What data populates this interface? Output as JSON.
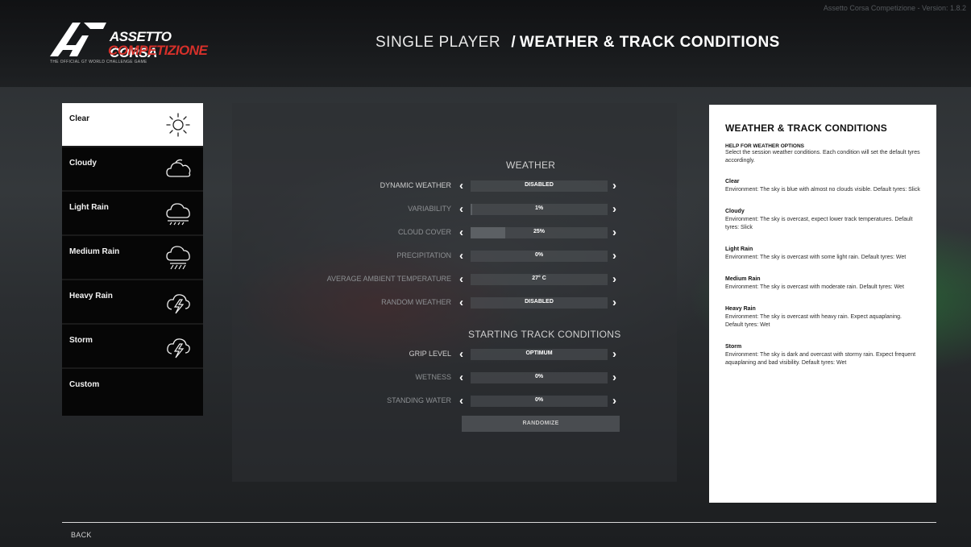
{
  "app": {
    "version": "Assetto Corsa Competizione - Version: 1.8.2",
    "logo_line1": "ASSETTO CORSA",
    "logo_line2": "COMPETIZIONE",
    "logo_tagline": "THE OFFICIAL GT WORLD CHALLENGE GAME"
  },
  "header": {
    "crumb": "SINGLE PLAYER",
    "separator": "/",
    "page": "WEATHER & TRACK CONDITIONS"
  },
  "presets": [
    {
      "label": "Clear",
      "icon": "sun-icon",
      "selected": true
    },
    {
      "label": "Cloudy",
      "icon": "cloud-icon",
      "selected": false
    },
    {
      "label": "Light Rain",
      "icon": "light-rain-icon",
      "selected": false
    },
    {
      "label": "Medium Rain",
      "icon": "medium-rain-icon",
      "selected": false
    },
    {
      "label": "Heavy Rain",
      "icon": "heavy-rain-storm-icon",
      "selected": false
    },
    {
      "label": "Storm",
      "icon": "storm-icon",
      "selected": false
    },
    {
      "label": "Custom",
      "icon": "",
      "selected": false
    }
  ],
  "weather": {
    "title": "WEATHER",
    "rows": [
      {
        "label": "DYNAMIC WEATHER",
        "value": "DISABLED",
        "fill": 0,
        "dim": false
      },
      {
        "label": "VARIABILITY",
        "value": "1%",
        "fill": 0.01,
        "dim": true
      },
      {
        "label": "CLOUD COVER",
        "value": "25%",
        "fill": 0.25,
        "dim": true
      },
      {
        "label": "PRECIPITATION",
        "value": "0%",
        "fill": 0,
        "dim": true
      },
      {
        "label": "AVERAGE AMBIENT TEMPERATURE",
        "value": "27° C",
        "fill": 0,
        "dim": true
      },
      {
        "label": "RANDOM WEATHER",
        "value": "DISABLED",
        "fill": 0,
        "dim": true
      }
    ]
  },
  "track": {
    "title": "STARTING TRACK CONDITIONS",
    "rows": [
      {
        "label": "GRIP LEVEL",
        "value": "OPTIMUM",
        "fill": 0,
        "dim": false
      },
      {
        "label": "WETNESS",
        "value": "0%",
        "fill": 0,
        "dim": true
      },
      {
        "label": "STANDING WATER",
        "value": "0%",
        "fill": 0,
        "dim": true
      }
    ],
    "randomize_label": "RANDOMIZE"
  },
  "help": {
    "title": "WEATHER & TRACK CONDITIONS",
    "intro_title": "HELP FOR WEATHER OPTIONS",
    "intro_text": "Select the session weather conditions. Each condition will set the default tyres accordingly.",
    "entries": [
      {
        "title": "Clear",
        "text": "Environment: The sky is blue with almost no clouds visible. Default tyres: Slick"
      },
      {
        "title": "Cloudy",
        "text": "Environment: The sky is overcast, expect lower track temperatures. Default tyres: Slick"
      },
      {
        "title": "Light Rain",
        "text": "Environment: The sky is overcast with some light rain. Default tyres: Wet"
      },
      {
        "title": "Medium Rain",
        "text": "Environment: The sky is overcast with moderate rain. Default tyres: Wet"
      },
      {
        "title": "Heavy Rain",
        "text": "Environment: The sky is overcast with heavy rain. Expect aquaplaning. Default tyres: Wet"
      },
      {
        "title": "Storm",
        "text": "Environment: The sky is dark and overcast with stormy rain. Expect frequent aquaplaning and bad visibility. Default tyres: Wet"
      }
    ]
  },
  "footer": {
    "back_label": "BACK"
  }
}
